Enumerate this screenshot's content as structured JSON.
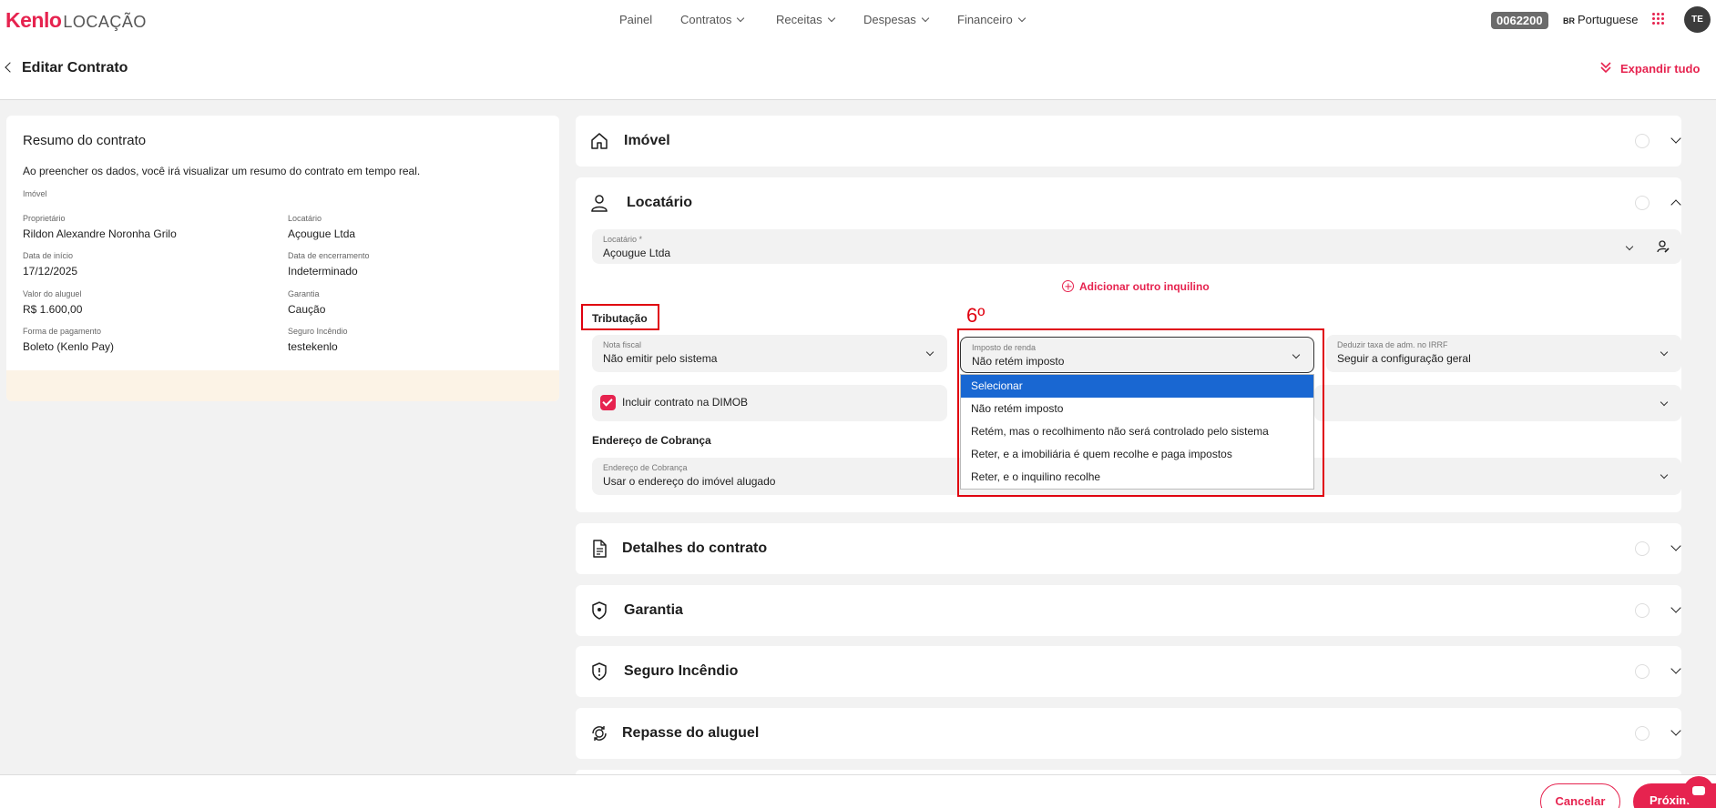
{
  "topnav": {
    "logo_brand": "Kenlo",
    "logo_product": "LOCAÇÃO",
    "items": [
      {
        "label": "Painel"
      },
      {
        "label": "Contratos"
      },
      {
        "label": "Receitas"
      },
      {
        "label": "Despesas"
      },
      {
        "label": "Financeiro"
      }
    ],
    "account_code": "0062200",
    "lang_flag": "BR",
    "lang_label": "Portuguese",
    "avatar_initials": "TE"
  },
  "header": {
    "title": "Editar Contrato",
    "expand_label": "Expandir tudo"
  },
  "summary": {
    "title": "Resumo do contrato",
    "description": "Ao preencher os dados, você irá visualizar um resumo do contrato em tempo real.",
    "property_label": "Imóvel",
    "owner_label": "Proprietário",
    "owner_value": "Rildon Alexandre Noronha Grilo",
    "tenant_label": "Locatário",
    "tenant_value": "Açougue Ltda",
    "start_label": "Data de início",
    "start_value": "17/12/2025",
    "end_label": "Data de encerramento",
    "end_value": "Indeterminado",
    "rent_label": "Valor do aluguel",
    "rent_value": "R$ 1.600,00",
    "guarantee_label": "Garantia",
    "guarantee_value": "Caução",
    "payment_label": "Forma de pagamento",
    "payment_value": "Boleto (Kenlo Pay)",
    "insurance_label": "Seguro Incêndio",
    "insurance_value": "testekenlo"
  },
  "sections": {
    "imovel": "Imóvel",
    "locatario": "Locatário",
    "detalhes": "Detalhes do contrato",
    "garantia": "Garantia",
    "seguro": "Seguro Incêndio",
    "repasse": "Repasse do aluguel"
  },
  "locatario": {
    "field_label": "Locatário *",
    "field_value": "Açougue Ltda",
    "add_label": "Adicionar outro inquilino",
    "tax_title": "Tributação",
    "step_marker": "6º",
    "nota_label": "Nota fiscal",
    "nota_value": "Não emitir pelo sistema",
    "ir_label": "Imposto de renda",
    "ir_value": "Não retém imposto",
    "deduct_label": "Deduzir taxa de adm. no IRRF",
    "deduct_value": "Seguir a configuração geral",
    "dimob_label": "Incluir contrato na DIMOB",
    "billing_title": "Endereço de Cobrança",
    "billing_label": "Endereço de Cobrança",
    "billing_value": "Usar o endereço do imóvel alugado"
  },
  "ir_dropdown_options": [
    "Selecionar",
    "Não retém imposto",
    "Retém, mas o recolhimento não será controlado pelo sistema",
    "Reter, e a imobiliária é quem recolhe e paga impostos",
    "Reter, e o inquilino recolhe"
  ],
  "footer": {
    "cancel_label": "Cancelar",
    "next_label": "Próximo"
  },
  "colors": {
    "brand": "#e6234f",
    "annotation_red": "#e0000f",
    "selected_option": "#1967d2"
  }
}
